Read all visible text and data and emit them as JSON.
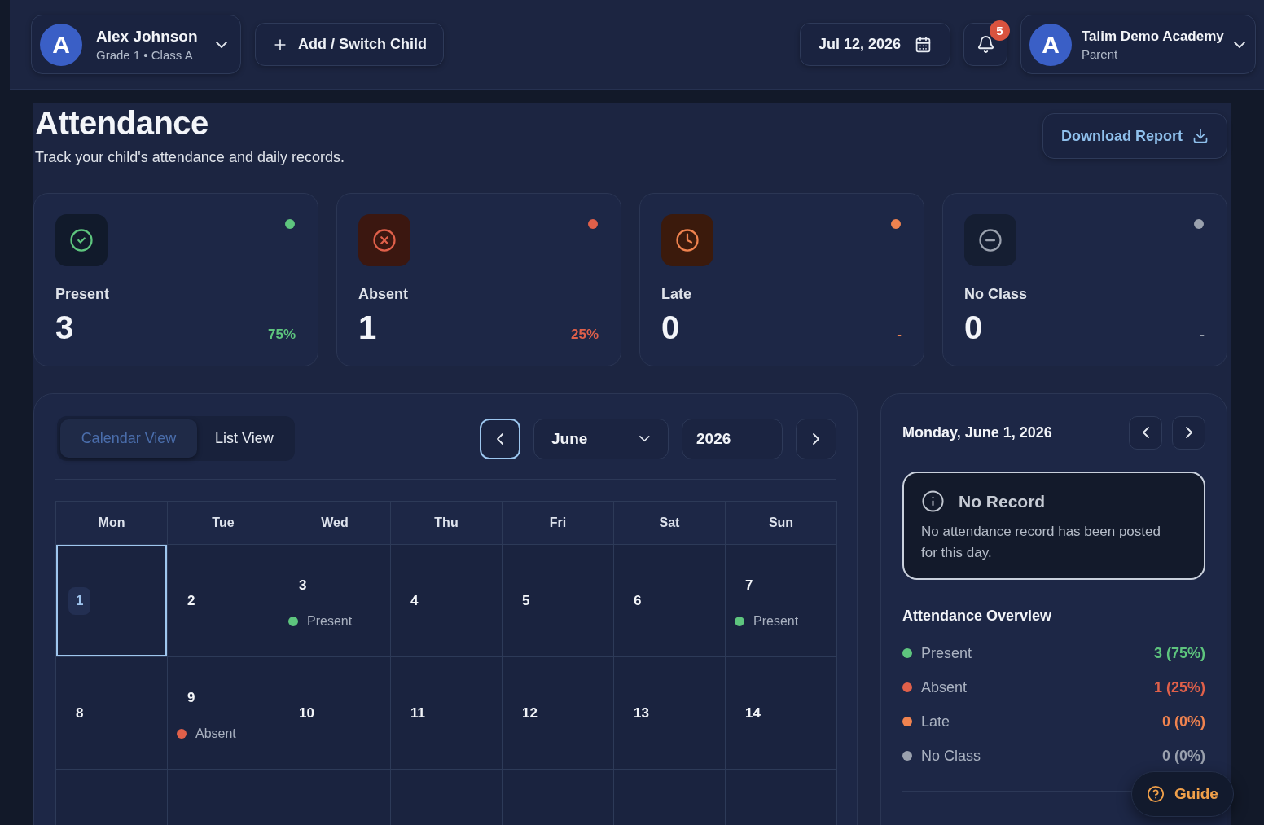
{
  "topbar": {
    "child": {
      "initial": "A",
      "name": "Alex Johnson",
      "details": "Grade 1 • Class A"
    },
    "add_child_button": {
      "label": "Add / Switch Child"
    },
    "date_button": {
      "label": "Jul 12, 2026"
    },
    "notifications": {
      "count": "5"
    },
    "account": {
      "initial": "A",
      "name": "Talim Demo Academy",
      "role": "Parent"
    }
  },
  "header": {
    "title": "Attendance",
    "subtitle": "Track your child's attendance and daily records.",
    "download_button": "Download Report"
  },
  "stats": [
    {
      "kind": "present",
      "label": "Present",
      "value": "3",
      "share": "75%",
      "color": "#5ec57e"
    },
    {
      "kind": "absent",
      "label": "Absent",
      "value": "1",
      "share": "25%",
      "color": "#e0604a"
    },
    {
      "kind": "late",
      "label": "Late",
      "value": "0",
      "share": "-",
      "color": "#f0834f"
    },
    {
      "kind": "no_class",
      "label": "No Class",
      "value": "0",
      "share": "-",
      "color": "#9aa1ae"
    }
  ],
  "calendar": {
    "view_tabs": [
      {
        "label": "Calendar View",
        "selected": true
      },
      {
        "label": "List View",
        "selected": false
      }
    ],
    "prev_button": {
      "focused": true
    },
    "month": "June",
    "year": "2026",
    "next_button": {
      "focused": false
    },
    "weekdays": [
      "Mon",
      "Tue",
      "Wed",
      "Thu",
      "Fri",
      "Sat",
      "Sun"
    ],
    "weeks": [
      [
        {
          "day": "1",
          "selected": true
        },
        {
          "day": "2",
          "selected": false
        },
        {
          "day": "3",
          "selected": false,
          "status": {
            "label": "Present",
            "color": "#5ec57e"
          }
        },
        {
          "day": "4",
          "selected": false
        },
        {
          "day": "5",
          "selected": false
        },
        {
          "day": "6",
          "selected": false
        },
        {
          "day": "7",
          "selected": false,
          "status": {
            "label": "Present",
            "color": "#5ec57e"
          }
        }
      ],
      [
        {
          "day": "8",
          "selected": false
        },
        {
          "day": "9",
          "selected": false,
          "status": {
            "label": "Absent",
            "color": "#e0604a"
          }
        },
        {
          "day": "10",
          "selected": false
        },
        {
          "day": "11",
          "selected": false
        },
        {
          "day": "12",
          "selected": false
        },
        {
          "day": "13",
          "selected": false
        },
        {
          "day": "14",
          "selected": false
        }
      ]
    ]
  },
  "day_detail": {
    "date": "Monday, June 1, 2026",
    "record": {
      "title": "No Record",
      "message": "No attendance record has been posted for this day."
    }
  },
  "overview": {
    "title": "Attendance Overview",
    "rows": [
      {
        "label": "Present",
        "value": "3 (75%)",
        "color": "#5ec57e"
      },
      {
        "label": "Absent",
        "value": "1 (25%)",
        "color": "#e0604a"
      },
      {
        "label": "Late",
        "value": "0 (0%)",
        "color": "#f0834f"
      },
      {
        "label": "No Class",
        "value": "0 (0%)",
        "color": "#9aa1ae"
      }
    ]
  },
  "guide_button": {
    "label": "Guide"
  }
}
